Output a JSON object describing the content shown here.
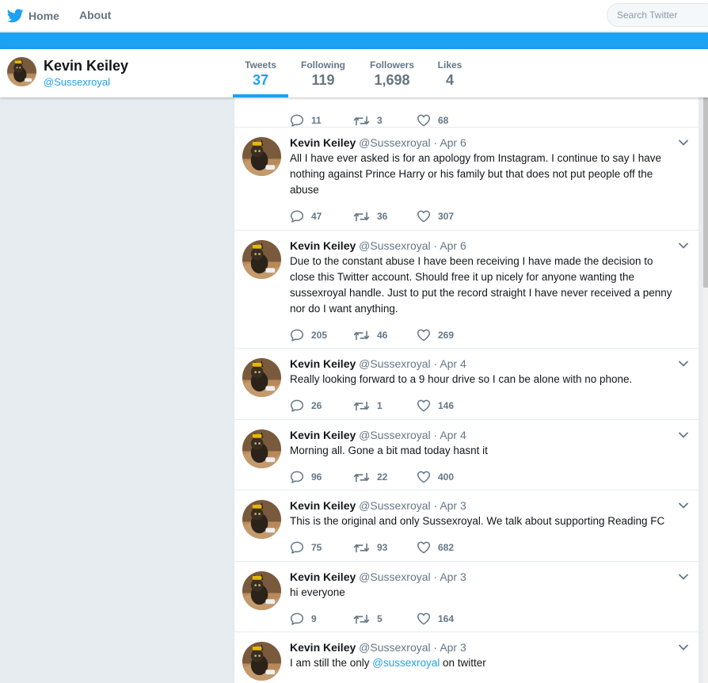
{
  "topnav": {
    "home_label": "Home",
    "about_label": "About",
    "search_placeholder": "Search Twitter"
  },
  "colors": {
    "accent": "#1da1f2",
    "text": "#14171a",
    "muted": "#657786",
    "background": "#e6ecf0"
  },
  "profile": {
    "name": "Kevin Keiley",
    "handle": "@Sussexroyal",
    "stats": [
      {
        "label": "Tweets",
        "value": "37"
      },
      {
        "label": "Following",
        "value": "119"
      },
      {
        "label": "Followers",
        "value": "1,698"
      },
      {
        "label": "Likes",
        "value": "4"
      }
    ]
  },
  "stub": {
    "replies": "11",
    "retweets": "3",
    "likes": "68"
  },
  "tweets": [
    {
      "name": "Kevin Keiley",
      "handle": "@Sussexroyal",
      "dot": "·",
      "date": "Apr 6",
      "text": "All I have ever asked is for an apology from Instagram. I continue to say I have nothing against Prince Harry or his family but that does not put people off the abuse",
      "replies": "47",
      "retweets": "36",
      "likes": "307"
    },
    {
      "name": "Kevin Keiley",
      "handle": "@Sussexroyal",
      "dot": "·",
      "date": "Apr 6",
      "text": "Due to the constant abuse I have been receiving I have made the decision to close this Twitter account. Should free it up nicely for anyone wanting the sussexroyal handle. Just to put the record straight I have never received a penny nor do I want anything.",
      "replies": "205",
      "retweets": "46",
      "likes": "269"
    },
    {
      "name": "Kevin Keiley",
      "handle": "@Sussexroyal",
      "dot": "·",
      "date": "Apr 4",
      "text": "Really looking forward to a 9 hour drive so I can be alone with no phone.",
      "replies": "26",
      "retweets": "1",
      "likes": "146"
    },
    {
      "name": "Kevin Keiley",
      "handle": "@Sussexroyal",
      "dot": "·",
      "date": "Apr 4",
      "text": "Morning all. Gone a bit mad today hasnt it",
      "replies": "96",
      "retweets": "22",
      "likes": "400"
    },
    {
      "name": "Kevin Keiley",
      "handle": "@Sussexroyal",
      "dot": "·",
      "date": "Apr 3",
      "text": "This is the original and only Sussexroyal. We talk about supporting Reading FC",
      "replies": "75",
      "retweets": "93",
      "likes": "682"
    },
    {
      "name": "Kevin Keiley",
      "handle": "@Sussexroyal",
      "dot": "·",
      "date": "Apr 3",
      "text": "hi everyone",
      "replies": "9",
      "retweets": "5",
      "likes": "164"
    },
    {
      "name": "Kevin Keiley",
      "handle": "@Sussexroyal",
      "dot": "·",
      "date": "Apr 3",
      "text_before": "I am still the only ",
      "mention": "@sussexroyal",
      "text_after": " on twitter"
    }
  ]
}
